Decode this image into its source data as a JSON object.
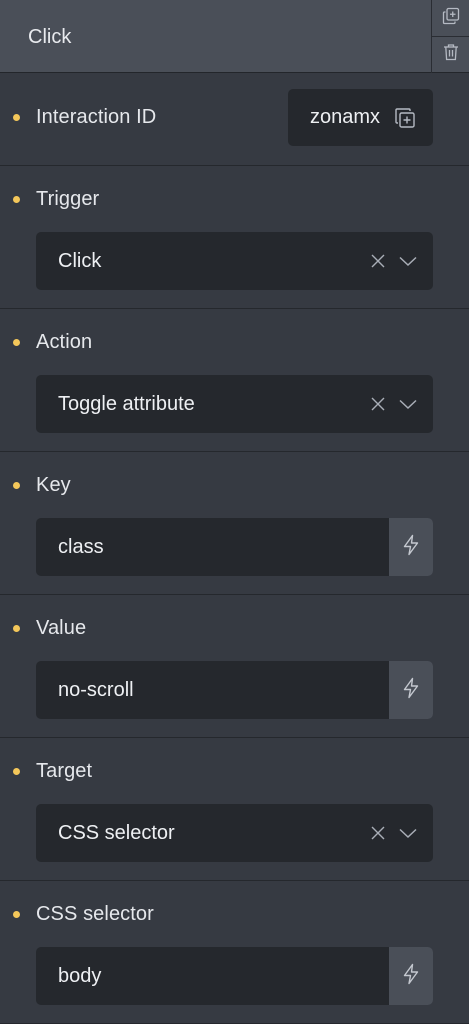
{
  "header": {
    "title": "Click"
  },
  "interaction_id": {
    "label": "Interaction ID",
    "value": "zonamx"
  },
  "trigger": {
    "label": "Trigger",
    "value": "Click"
  },
  "action": {
    "label": "Action",
    "value": "Toggle attribute"
  },
  "key": {
    "label": "Key",
    "value": "class"
  },
  "value_field": {
    "label": "Value",
    "value": "no-scroll"
  },
  "target": {
    "label": "Target",
    "value": "CSS selector"
  },
  "css_selector": {
    "label": "CSS selector",
    "value": "body"
  },
  "colors": {
    "panel_bg": "#363a42",
    "header_bg": "#4a4f58",
    "field_bg": "#25282d",
    "dot_accent": "#f4c75a"
  }
}
